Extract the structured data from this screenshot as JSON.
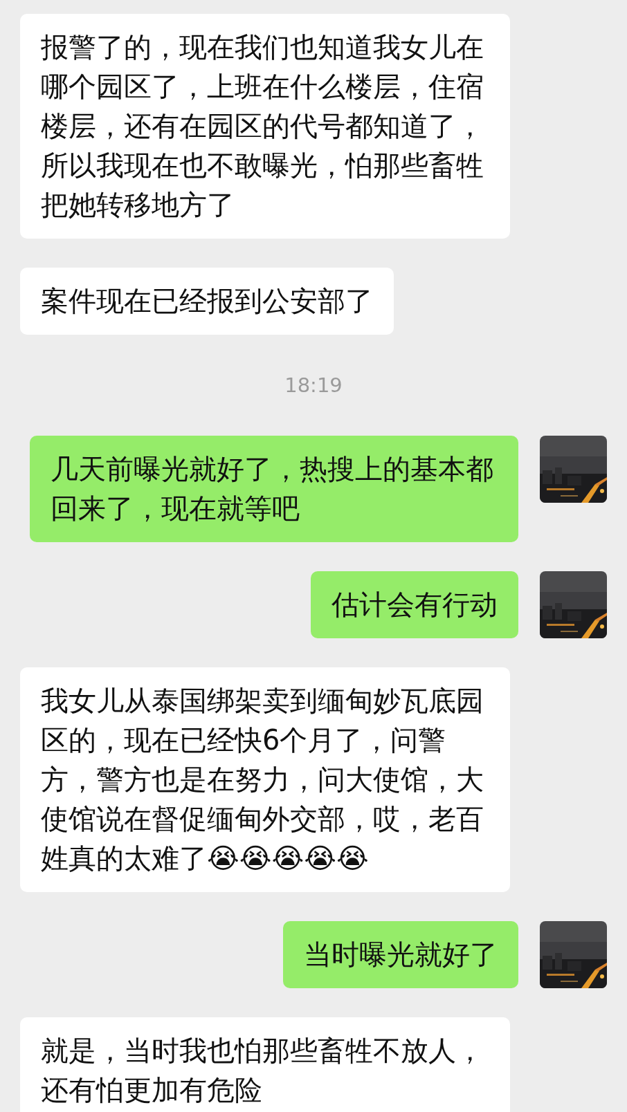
{
  "messages": [
    {
      "kind": "received",
      "text": "报警了的，现在我们也知道我女儿在哪个园区了，上班在什么楼层，住宿楼层，还有在园区的代号都知道了，所以我现在也不敢曝光，怕那些畜牲把她转移地方了"
    },
    {
      "kind": "received",
      "text": "案件现在已经报到公安部了"
    },
    {
      "kind": "time",
      "text": "18:19"
    },
    {
      "kind": "sent",
      "text": "几天前曝光就好了，热搜上的基本都回来了，现在就等吧"
    },
    {
      "kind": "sent",
      "text": "估计会有行动"
    },
    {
      "kind": "received",
      "text": "我女儿从泰国绑架卖到缅甸妙瓦底园区的，现在已经快6个月了，问警方，警方也是在努力，问大使馆，大使馆说在督促缅甸外交部，哎，老百姓真的太难了😭😭😭😭😭"
    },
    {
      "kind": "sent",
      "text": "当时曝光就好了"
    },
    {
      "kind": "received",
      "text": "就是，当时我也怕那些畜牲不放人，还有怕更加有危险"
    }
  ]
}
